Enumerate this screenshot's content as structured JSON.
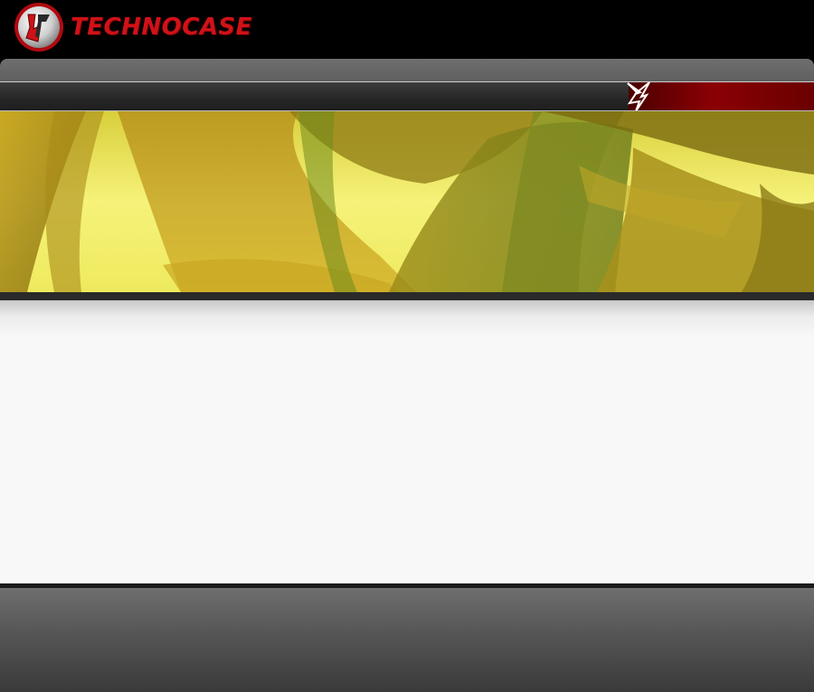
{
  "header": {
    "brand_name": "TECHNOCASE",
    "logo_icon": "technocase-logo-emblem"
  },
  "colors": {
    "brand_red": "#d01218",
    "nav_accent": "#8a0004",
    "banner_yellow": "#f2ef6a",
    "content_bg": "#f8f8f8"
  },
  "nav": {
    "accent_icon": "lightning-bolt-icon"
  }
}
